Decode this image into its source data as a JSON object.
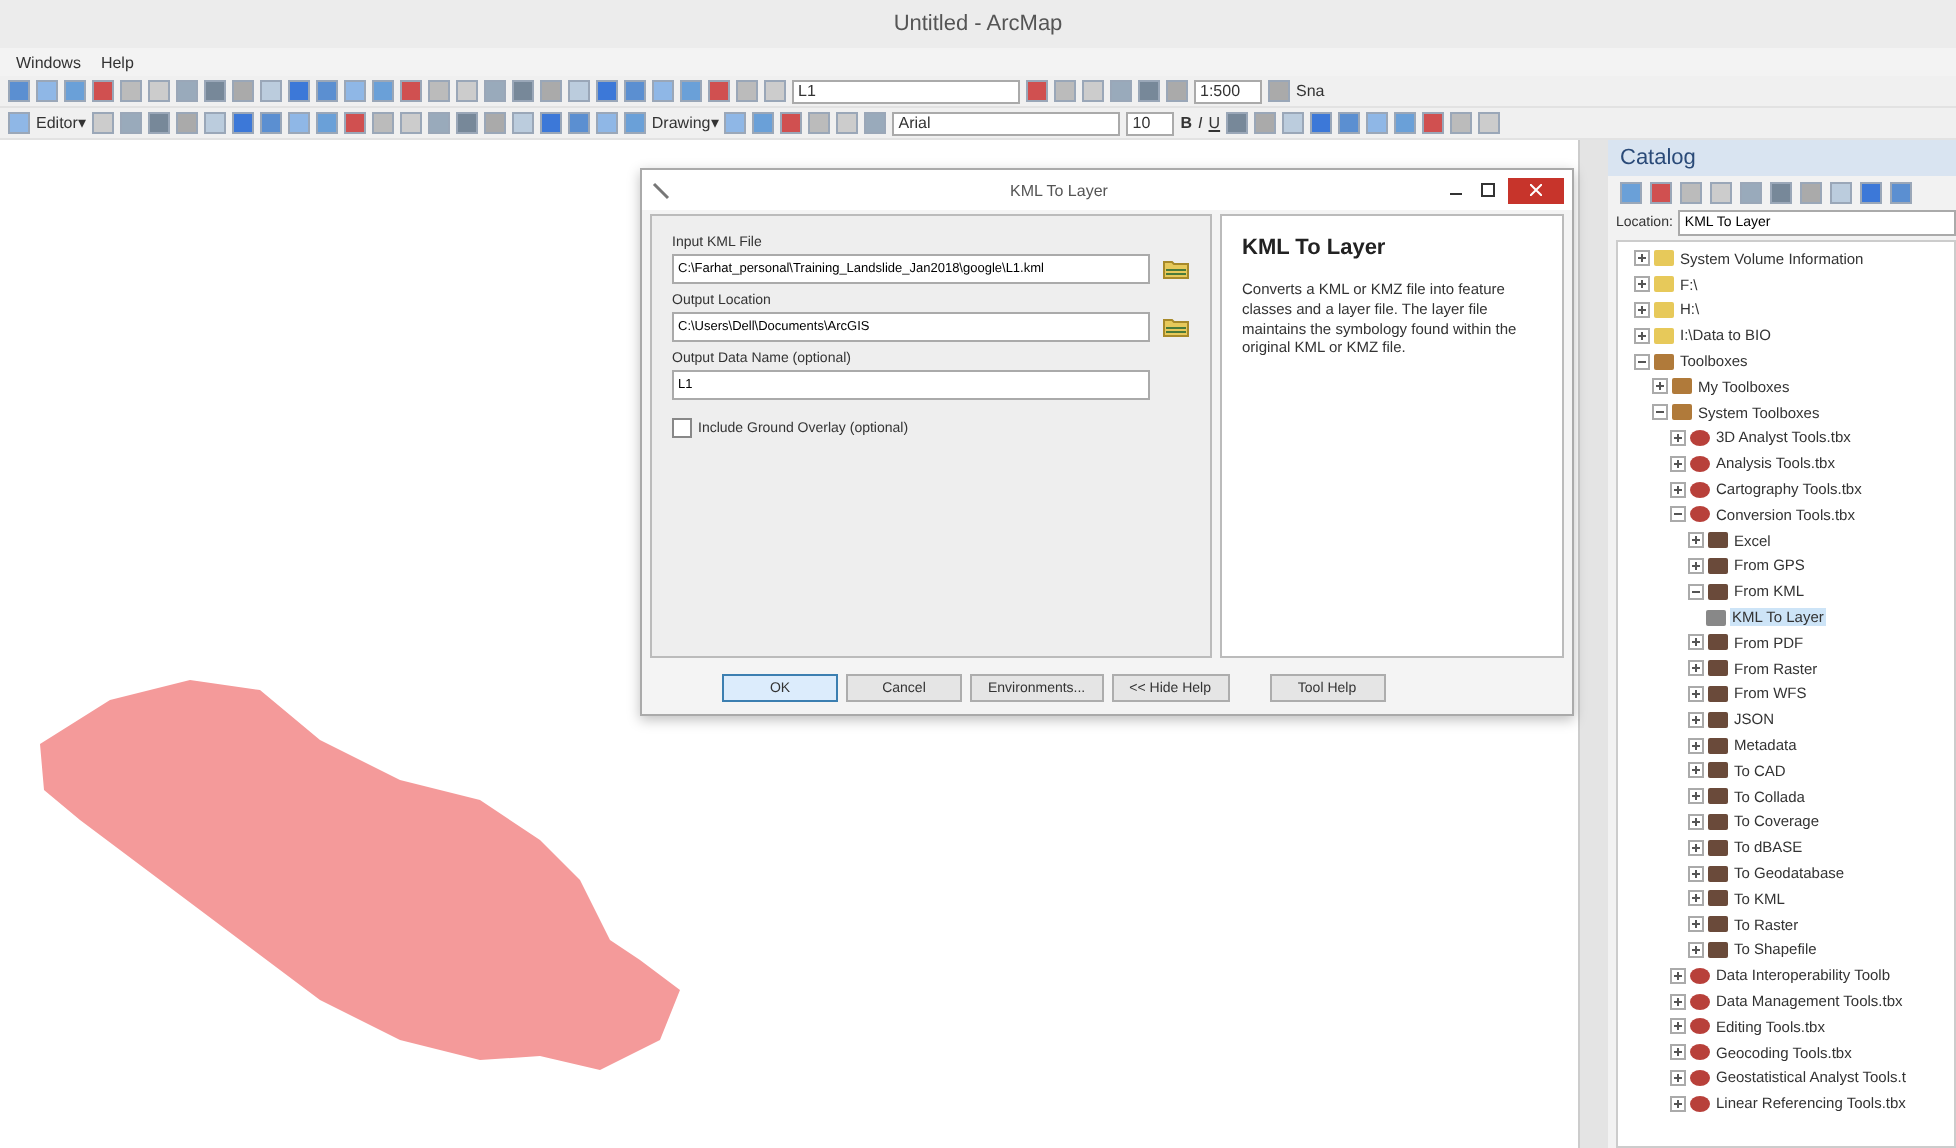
{
  "window": {
    "title": "Untitled - ArcMap"
  },
  "menu": [
    "Windows",
    "Help"
  ],
  "toolbar": {
    "scale": "1:500",
    "layer": "L1",
    "editor": "Editor▾",
    "drawing": "Drawing▾",
    "font": "Arial",
    "font_size": "10",
    "bold": "B",
    "italic": "I",
    "underline": "U",
    "snap": "Sna"
  },
  "dialog": {
    "title": "KML To Layer",
    "fields": [
      {
        "label": "Input KML File",
        "value": "C:\\Farhat_personal\\Training_Landslide_Jan2018\\google\\L1.kml",
        "browse": true
      },
      {
        "label": "Output Location",
        "value": "C:\\Users\\Dell\\Documents\\ArcGIS",
        "browse": true
      },
      {
        "label": "Output Data Name (optional)",
        "value": "L1",
        "browse": false
      }
    ],
    "checkbox": {
      "label": "Include Ground Overlay (optional)",
      "checked": false
    },
    "help": {
      "title": "KML To Layer",
      "text": "Converts a KML or KMZ file into feature classes and a layer file. The layer file maintains the symbology found within the original KML or KMZ file."
    },
    "buttons": [
      {
        "label": "OK",
        "selected": true
      },
      {
        "label": "Cancel",
        "selected": false
      },
      {
        "label": "Environments...",
        "selected": false
      },
      {
        "label": "<< Hide Help",
        "selected": false
      },
      {
        "label": "Tool Help",
        "selected": false
      }
    ]
  },
  "catalog": {
    "title": "Catalog",
    "location_label": "Location:",
    "location": "KML To Layer",
    "tree": [
      {
        "label": "System Volume Information",
        "kind": "folder",
        "expanded": false
      },
      {
        "label": "F:\\",
        "kind": "folder",
        "expanded": false
      },
      {
        "label": "H:\\",
        "kind": "folder",
        "expanded": false
      },
      {
        "label": "I:\\Data to BIO",
        "kind": "folder",
        "expanded": false
      },
      {
        "label": "Toolboxes",
        "kind": "toolboxes",
        "expanded": true,
        "children": [
          {
            "label": "My Toolboxes",
            "kind": "toolboxes",
            "expanded": false
          },
          {
            "label": "System Toolboxes",
            "kind": "toolboxes",
            "expanded": true,
            "children": [
              {
                "label": "3D Analyst Tools.tbx",
                "kind": "toolbox",
                "expanded": false
              },
              {
                "label": "Analysis Tools.tbx",
                "kind": "toolbox",
                "expanded": false
              },
              {
                "label": "Cartography Tools.tbx",
                "kind": "toolbox",
                "expanded": false
              },
              {
                "label": "Conversion Tools.tbx",
                "kind": "toolbox",
                "expanded": true,
                "children": [
                  {
                    "label": "Excel",
                    "kind": "toolset",
                    "expanded": false
                  },
                  {
                    "label": "From GPS",
                    "kind": "toolset",
                    "expanded": false
                  },
                  {
                    "label": "From KML",
                    "kind": "toolset",
                    "expanded": true,
                    "children": [
                      {
                        "label": "KML To Layer",
                        "kind": "tool",
                        "selected": true
                      }
                    ]
                  },
                  {
                    "label": "From PDF",
                    "kind": "toolset",
                    "expanded": false
                  },
                  {
                    "label": "From Raster",
                    "kind": "toolset",
                    "expanded": false
                  },
                  {
                    "label": "From WFS",
                    "kind": "toolset",
                    "expanded": false
                  },
                  {
                    "label": "JSON",
                    "kind": "toolset",
                    "expanded": false
                  },
                  {
                    "label": "Metadata",
                    "kind": "toolset",
                    "expanded": false
                  },
                  {
                    "label": "To CAD",
                    "kind": "toolset",
                    "expanded": false
                  },
                  {
                    "label": "To Collada",
                    "kind": "toolset",
                    "expanded": false
                  },
                  {
                    "label": "To Coverage",
                    "kind": "toolset",
                    "expanded": false
                  },
                  {
                    "label": "To dBASE",
                    "kind": "toolset",
                    "expanded": false
                  },
                  {
                    "label": "To Geodatabase",
                    "kind": "toolset",
                    "expanded": false
                  },
                  {
                    "label": "To KML",
                    "kind": "toolset",
                    "expanded": false
                  },
                  {
                    "label": "To Raster",
                    "kind": "toolset",
                    "expanded": false
                  },
                  {
                    "label": "To Shapefile",
                    "kind": "toolset",
                    "expanded": false
                  }
                ]
              },
              {
                "label": "Data Interoperability Toolb",
                "kind": "toolbox",
                "expanded": false
              },
              {
                "label": "Data Management Tools.tbx",
                "kind": "toolbox",
                "expanded": false
              },
              {
                "label": "Editing Tools.tbx",
                "kind": "toolbox",
                "expanded": false
              },
              {
                "label": "Geocoding Tools.tbx",
                "kind": "toolbox",
                "expanded": false
              },
              {
                "label": "Geostatistical Analyst Tools.t",
                "kind": "toolbox",
                "expanded": false
              },
              {
                "label": "Linear Referencing Tools.tbx",
                "kind": "toolbox",
                "expanded": false
              }
            ]
          }
        ]
      }
    ]
  }
}
